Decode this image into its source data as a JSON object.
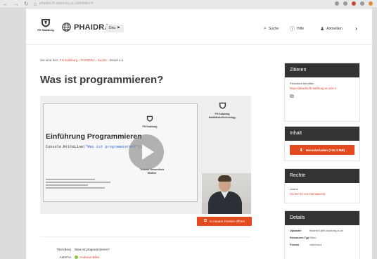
{
  "browser": {
    "url": "phaidra.fh-salzburg.ac.at/detail/o:4",
    "colors": {
      "chrome": "#e9e9ea",
      "ext_red": "#c9463d",
      "ext_orange": "#e48a3c"
    }
  },
  "header": {
    "logo_text": "FH Salzburg",
    "brand": "PHAIDRA",
    "language": "Deu",
    "search_label": "Suche",
    "help_label": "Hilfe",
    "login_label": "Anmelden",
    "more_label": "›"
  },
  "breadcrumb": {
    "prefix": "Sie sind hier:",
    "items": [
      "FH Salzburg",
      "PHAIDRA",
      "Suche"
    ],
    "current": "Detail o:4",
    "separator": "›"
  },
  "title": "Was ist programmieren?",
  "video": {
    "slide_heading": "Einführung Programmieren",
    "slide_code_prefix": "Console.WriteLine(",
    "slide_code_string": "\"Was ist programmieren?\"",
    "slide_code_suffix": ");",
    "slide_logo_text": "FH Salzburg",
    "slide_side_text": "Technik Gesundheit Medien",
    "corner_logo_text": "FH Salzburg",
    "corner_subtitle": "MultiMediaTechnology",
    "open_label": "In neuem Fenster öffnen"
  },
  "metadata": [
    {
      "key": "Titel (deu)",
      "value": "Was ist programmieren?",
      "link": false
    },
    {
      "key": "Autor*in",
      "value": "Andreas Bilke",
      "link": true
    }
  ],
  "panels": {
    "cite": {
      "title": "Zitieren",
      "label": "Persistent Identifier",
      "link": "https://phaidra.fh-salzburg.ac.at/o:4"
    },
    "content": {
      "title": "Inhalt",
      "download_label": "Herunterladen (744.3 MB)"
    },
    "rights": {
      "title": "Rechte",
      "label": "Lizenz",
      "license": "CC BY-SA 4.0 International"
    },
    "details": {
      "title": "Details",
      "rows": [
        {
          "key": "Uploader",
          "value": "fhadmin1@fh-salzburg.ac.at"
        },
        {
          "key": "Ressource-Typ",
          "value": "Video"
        },
        {
          "key": "Format",
          "value": "video/mp4"
        }
      ]
    }
  },
  "colors": {
    "accent": "#e34b1f",
    "link": "#e0442a",
    "panel_header": "#333333"
  }
}
